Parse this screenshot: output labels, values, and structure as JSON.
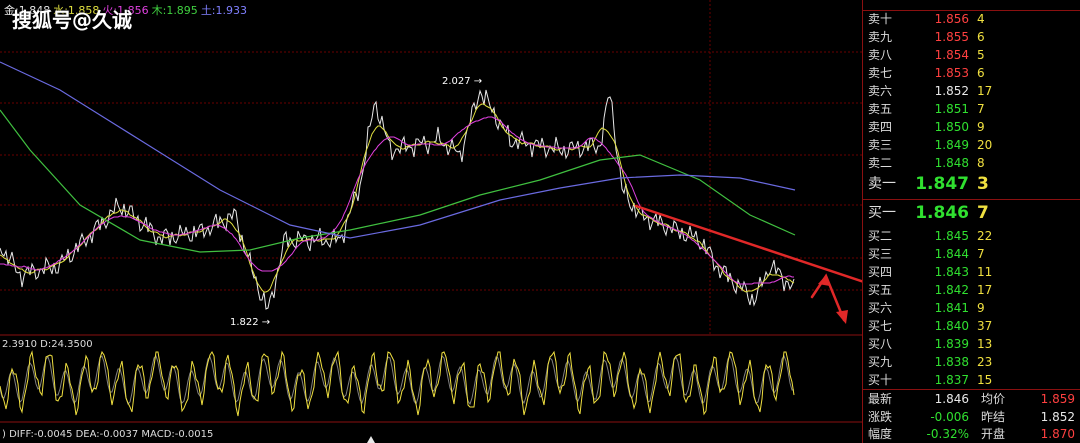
{
  "watermark": "搜狐号@久诚",
  "ma_legend": {
    "items": [
      {
        "label": "金:1.848",
        "color": "#e8e8e8"
      },
      {
        "label": "水:1.858",
        "color": "#e0e040"
      },
      {
        "label": "火:1.856",
        "color": "#e040e0"
      },
      {
        "label": "木:1.895",
        "color": "#40d040"
      },
      {
        "label": "土:1.933",
        "color": "#8080ff"
      }
    ]
  },
  "price_annotations": {
    "high": "2.027 →",
    "low": "1.822 →"
  },
  "kdj_label": "2.3910 D:24.3500",
  "macd_label": ") DIFF:-0.0045 DEA:-0.0037 MACD:-0.0015",
  "order_book": {
    "sells": [
      {
        "label": "卖十",
        "price": "1.856",
        "volume": "4",
        "color": "red"
      },
      {
        "label": "卖九",
        "price": "1.855",
        "volume": "6",
        "color": "red"
      },
      {
        "label": "卖八",
        "price": "1.854",
        "volume": "5",
        "color": "red"
      },
      {
        "label": "卖七",
        "price": "1.853",
        "volume": "6",
        "color": "red"
      },
      {
        "label": "卖六",
        "price": "1.852",
        "volume": "17",
        "color": "wht"
      },
      {
        "label": "卖五",
        "price": "1.851",
        "volume": "7",
        "color": "grn"
      },
      {
        "label": "卖四",
        "price": "1.850",
        "volume": "9",
        "color": "grn"
      },
      {
        "label": "卖三",
        "price": "1.849",
        "volume": "20",
        "color": "grn"
      },
      {
        "label": "卖二",
        "price": "1.848",
        "volume": "8",
        "color": "grn"
      },
      {
        "label": "卖一",
        "price": "1.847",
        "volume": "3",
        "color": "grn"
      }
    ],
    "buys": [
      {
        "label": "买一",
        "price": "1.846",
        "volume": "7",
        "color": "grn"
      },
      {
        "label": "买二",
        "price": "1.845",
        "volume": "22",
        "color": "grn"
      },
      {
        "label": "买三",
        "price": "1.844",
        "volume": "7",
        "color": "grn"
      },
      {
        "label": "买四",
        "price": "1.843",
        "volume": "11",
        "color": "grn"
      },
      {
        "label": "买五",
        "price": "1.842",
        "volume": "17",
        "color": "grn"
      },
      {
        "label": "买六",
        "price": "1.841",
        "volume": "9",
        "color": "grn"
      },
      {
        "label": "买七",
        "price": "1.840",
        "volume": "37",
        "color": "grn"
      },
      {
        "label": "买八",
        "price": "1.839",
        "volume": "13",
        "color": "grn"
      },
      {
        "label": "买九",
        "price": "1.838",
        "volume": "23",
        "color": "grn"
      },
      {
        "label": "买十",
        "price": "1.837",
        "volume": "15",
        "color": "grn"
      }
    ]
  },
  "stats": {
    "latest_label": "最新",
    "latest": "1.846",
    "avg_label": "均价",
    "avg": "1.859",
    "change_label": "涨跌",
    "change": "-0.006",
    "prev_label": "昨结",
    "prev": "1.852",
    "range_label": "幅度",
    "range": "-0.32%",
    "open_label": "开盘",
    "open": "1.870"
  },
  "colors": {
    "sell_red": "#ff4040",
    "green": "#30e030",
    "volume_yellow": "#f0e040",
    "frame": "#8a1010"
  }
}
